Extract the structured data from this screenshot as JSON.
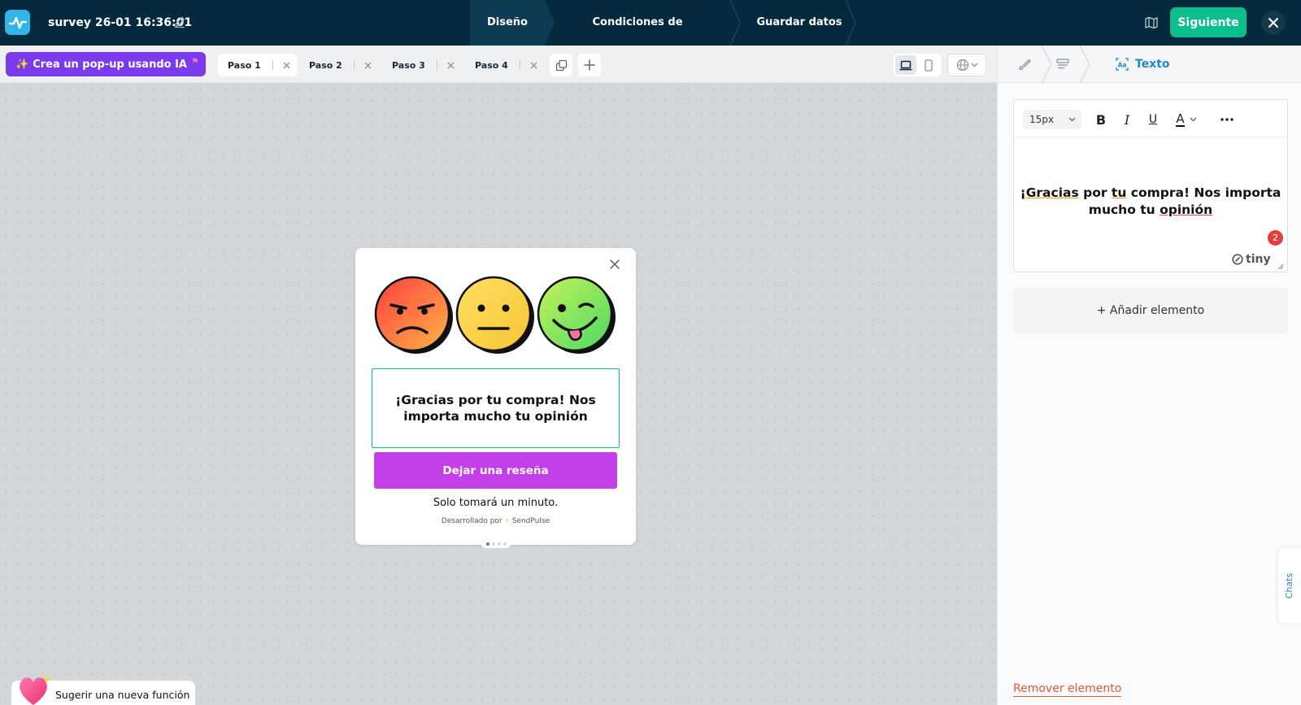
{
  "header": {
    "title": "survey 26-01 16:36:01",
    "steps": [
      "Diseño",
      "Condiciones de visualización",
      "Guardar datos"
    ],
    "next_label": "Siguiente"
  },
  "toolbar": {
    "ai_label": "Crea un pop-up usando IA",
    "step_tabs": [
      "Paso 1",
      "Paso 2",
      "Paso 3",
      "Paso 4"
    ]
  },
  "popup": {
    "text": "¡Gracias por tu compra! Nos importa mucho tu opinión",
    "button_label": "Dejar una reseña",
    "subtext": "Solo tomará un minuto.",
    "brand_prefix": "Desarrollado por",
    "brand_name": "SendPulse"
  },
  "footer": {
    "suggest_label": "Sugerir una nueva función"
  },
  "panel": {
    "active_tab": "Texto",
    "font_size": "15px",
    "editor_text_1": "¡Gracias",
    "editor_text_2": " por ",
    "editor_text_3": "tu",
    "editor_text_4": " compra! Nos importa mucho tu ",
    "editor_text_5": "opinión",
    "notification_count": "2",
    "tiny_label": "tiny",
    "add_element": "+ Añadir elemento",
    "remove_element": "Remover elemento",
    "chats_label": "Chats"
  },
  "colors": {
    "topbar": "#05293d",
    "accent_green": "#0bbf8a",
    "ai_purple": "#7c3aed",
    "popup_button": "#c340e8",
    "link_blue": "#1e88c9",
    "danger": "#e5553a"
  },
  "icons": [
    "logo-pulse-icon",
    "pencil-icon",
    "map-icon",
    "close-icon",
    "duplicate-icon",
    "plus-icon",
    "laptop-icon",
    "mobile-icon",
    "globe-icon",
    "chevron-down-icon",
    "paintbrush-icon",
    "layout-icon",
    "text-icon",
    "heart-icon"
  ]
}
